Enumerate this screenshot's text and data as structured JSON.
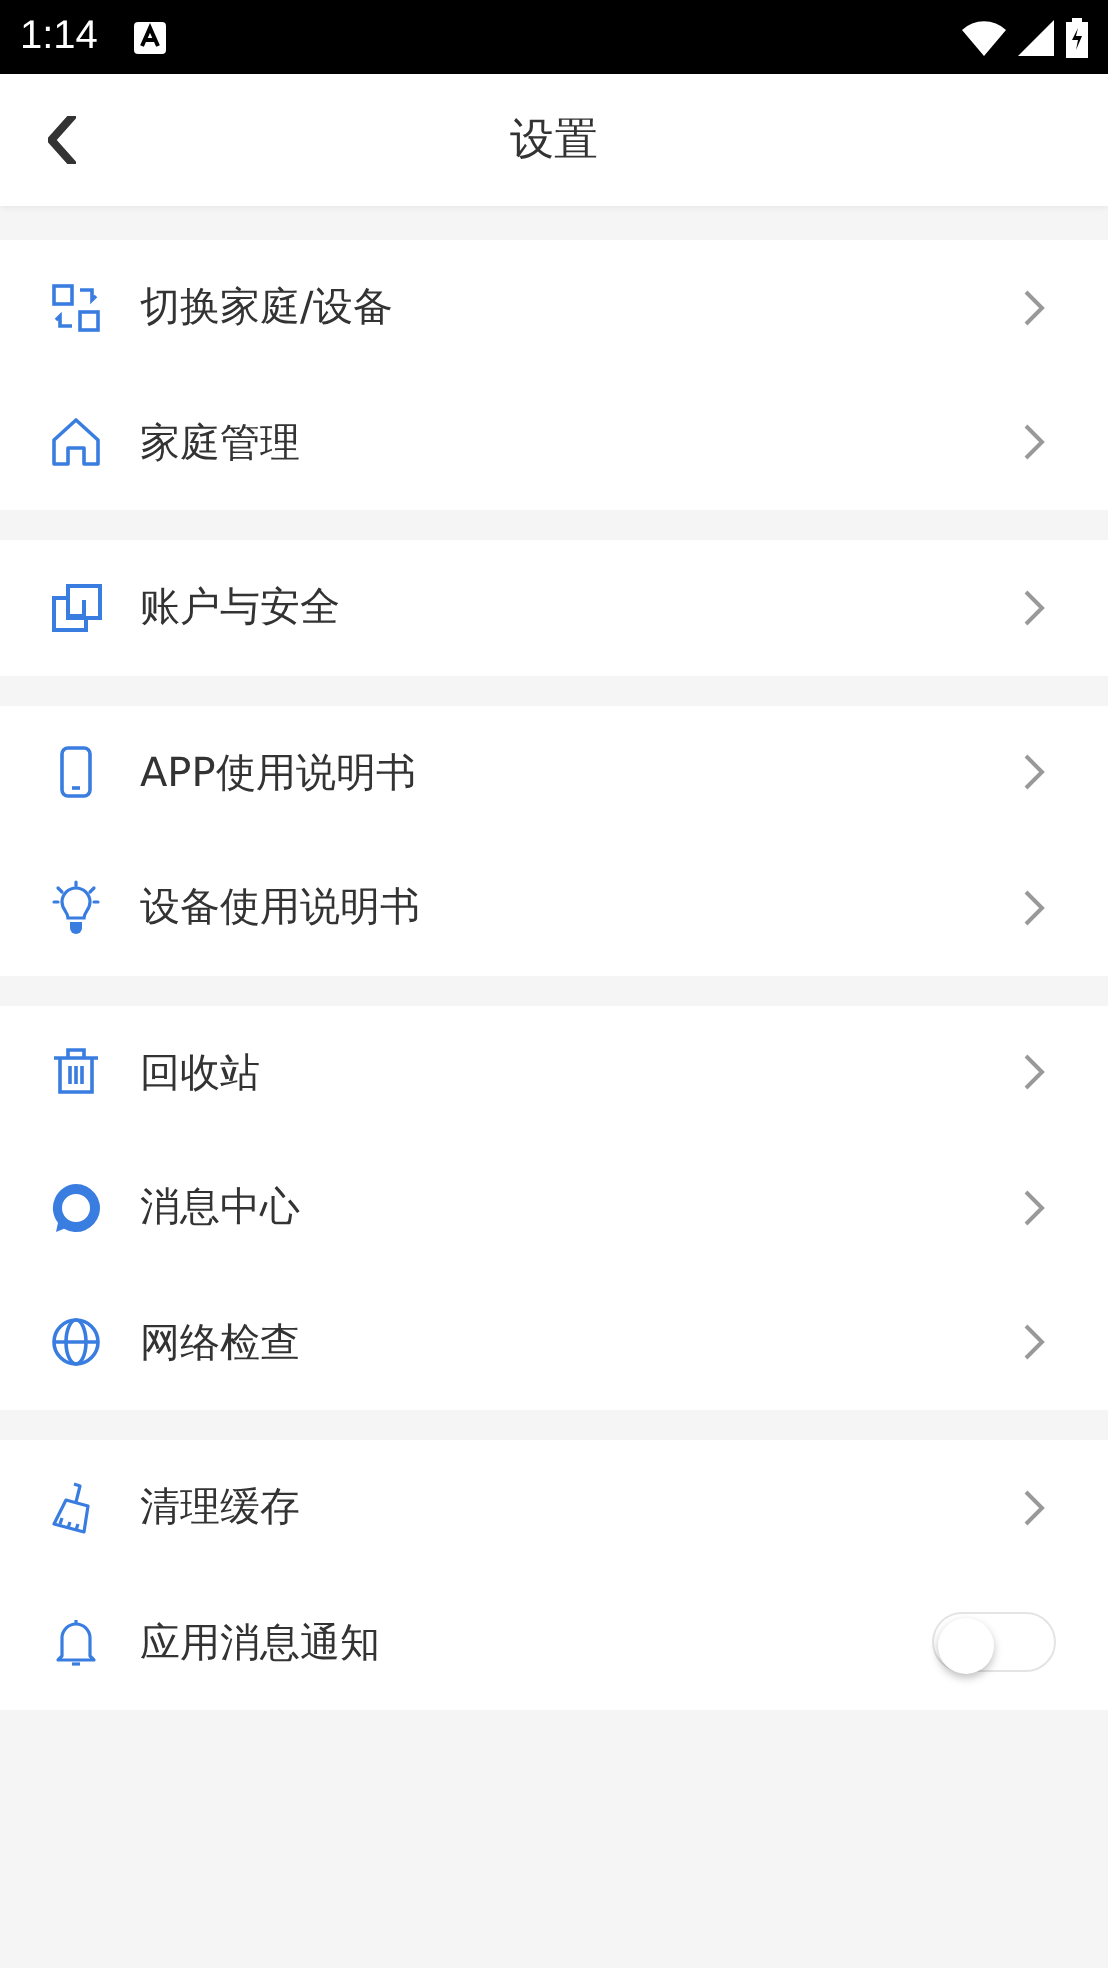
{
  "status_bar": {
    "time": "1:14"
  },
  "header": {
    "title": "设置"
  },
  "groups": [
    {
      "items": [
        {
          "kind": "link",
          "label": "切换家庭/设备"
        },
        {
          "kind": "link",
          "label": "家庭管理"
        }
      ]
    },
    {
      "items": [
        {
          "kind": "link",
          "label": "账户与安全"
        }
      ]
    },
    {
      "items": [
        {
          "kind": "link",
          "label": "APP使用说明书"
        },
        {
          "kind": "link",
          "label": "设备使用说明书"
        }
      ]
    },
    {
      "items": [
        {
          "kind": "link",
          "label": "回收站"
        },
        {
          "kind": "link",
          "label": "消息中心"
        },
        {
          "kind": "link",
          "label": "网络检查"
        }
      ]
    },
    {
      "items": [
        {
          "kind": "link",
          "label": "清理缓存"
        },
        {
          "kind": "toggle",
          "label": "应用消息通知",
          "on": false
        }
      ]
    }
  ]
}
